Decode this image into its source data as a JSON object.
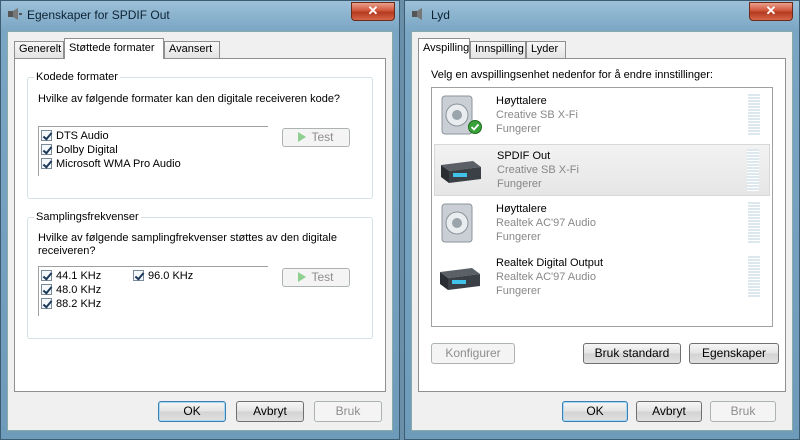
{
  "left_window": {
    "title": "Egenskaper for SPDIF Out",
    "close_label": "✕",
    "tabs": [
      "Generelt",
      "Støttede formater",
      "Avansert"
    ],
    "active_tab": 1,
    "encoded_formats": {
      "legend": "Kodede formater",
      "prompt": "Hvilke av følgende formater kan den digitale receiveren kode?",
      "items": [
        "DTS Audio",
        "Dolby Digital",
        "Microsoft WMA Pro Audio"
      ],
      "test_label": "Test"
    },
    "sample_rates": {
      "legend": "Samplingsfrekvenser",
      "prompt_line1": "Hvilke av følgende samplingfrekvenser støttes av den digitale",
      "prompt_line2": "receiveren?",
      "items_col1": [
        "44.1 KHz",
        "48.0 KHz",
        "88.2 KHz"
      ],
      "items_col2": [
        "96.0 KHz"
      ],
      "test_label": "Test"
    },
    "buttons": {
      "ok": "OK",
      "cancel": "Avbryt",
      "apply": "Bruk"
    }
  },
  "right_window": {
    "title": "Lyd",
    "close_label": "✕",
    "tabs": [
      "Avspilling",
      "Innspilling",
      "Lyder"
    ],
    "active_tab": 0,
    "instruction": "Velg en avspillingsenhet nedenfor for å endre innstillinger:",
    "devices": [
      {
        "name": "Høyttalere",
        "sub": "Creative SB X-Fi",
        "status": "Fungerer",
        "icon": "speaker-icon",
        "default": true
      },
      {
        "name": "SPDIF Out",
        "sub": "Creative SB X-Fi",
        "status": "Fungerer",
        "icon": "receiver-icon",
        "selected": true
      },
      {
        "name": "Høyttalere",
        "sub": "Realtek AC'97 Audio",
        "status": "Fungerer",
        "icon": "speaker-icon"
      },
      {
        "name": "Realtek Digital Output",
        "sub": "Realtek AC'97 Audio",
        "status": "Fungerer",
        "icon": "receiver-icon"
      }
    ],
    "action_buttons": {
      "configure": "Konfigurer",
      "set_default": "Bruk standard",
      "properties": "Egenskaper"
    },
    "buttons": {
      "ok": "OK",
      "cancel": "Avbryt",
      "apply": "Bruk"
    }
  }
}
